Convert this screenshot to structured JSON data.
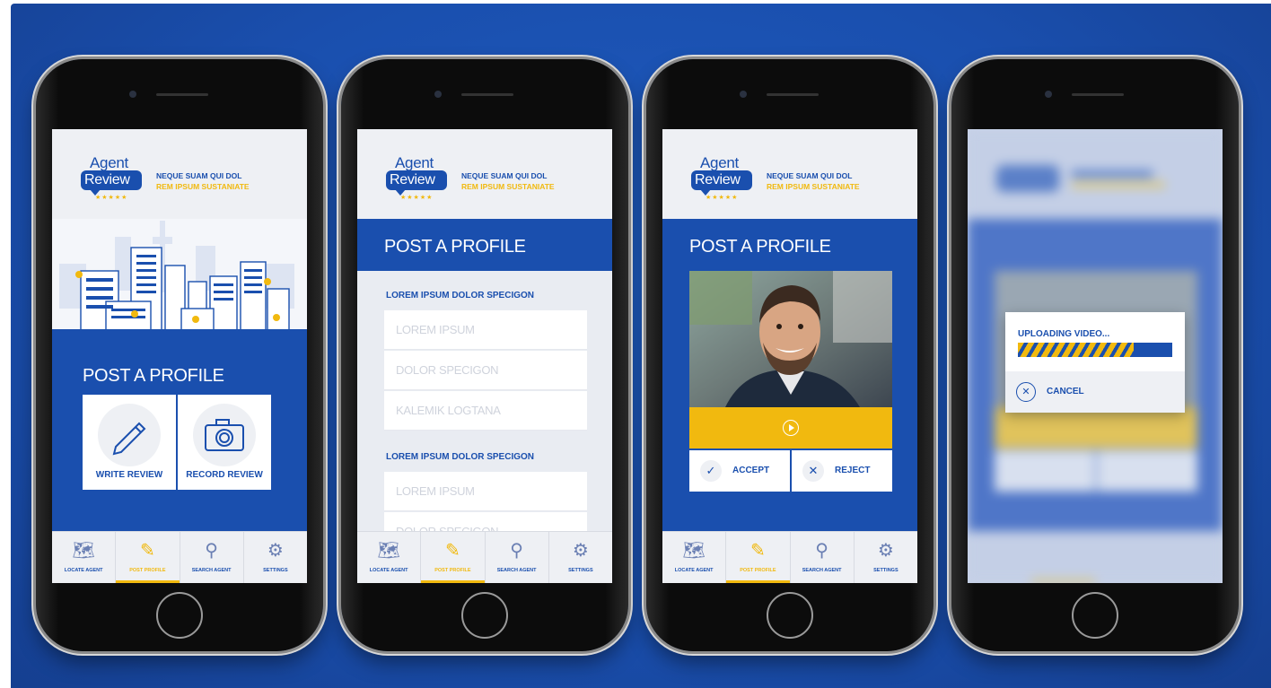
{
  "brand": {
    "line1": "Agent",
    "line2": "Review",
    "stars": "★★★★★"
  },
  "tagline": {
    "line1": "NEQUE SUAM QUI DOL",
    "line2": "REM IPSUM SUSTANIATE"
  },
  "colors": {
    "primary": "#1a4fae",
    "accent": "#f1b90f",
    "background": "#eef0f4"
  },
  "post_title": "POST A PROFILE",
  "nav": [
    {
      "label": "LOCATE AGENT",
      "icon": "map-icon"
    },
    {
      "label": "POST PROFILE",
      "icon": "pencil-ruler-icon"
    },
    {
      "label": "SEARCH AGENT",
      "icon": "search-icon"
    },
    {
      "label": "SETTINGS",
      "icon": "gear-icon"
    }
  ],
  "screen1": {
    "write_review": "WRITE REVIEW",
    "record_review": "RECORD REVIEW"
  },
  "screen2": {
    "section1": "LOREM IPSUM DOLOR SPECIGON",
    "fields1": [
      "LOREM IPSUM",
      "DOLOR SPECIGON",
      "KALEMIK LOGTANA"
    ],
    "section2": "LOREM IPSUM DOLOR SPECIGON",
    "fields2": [
      "LOREM IPSUM",
      "DOLOR SPECIGON"
    ]
  },
  "screen3": {
    "accept": "ACCEPT",
    "reject": "REJECT"
  },
  "screen4": {
    "uploading": "UPLOADING VIDEO...",
    "progress": 0.75,
    "cancel": "CANCEL"
  }
}
